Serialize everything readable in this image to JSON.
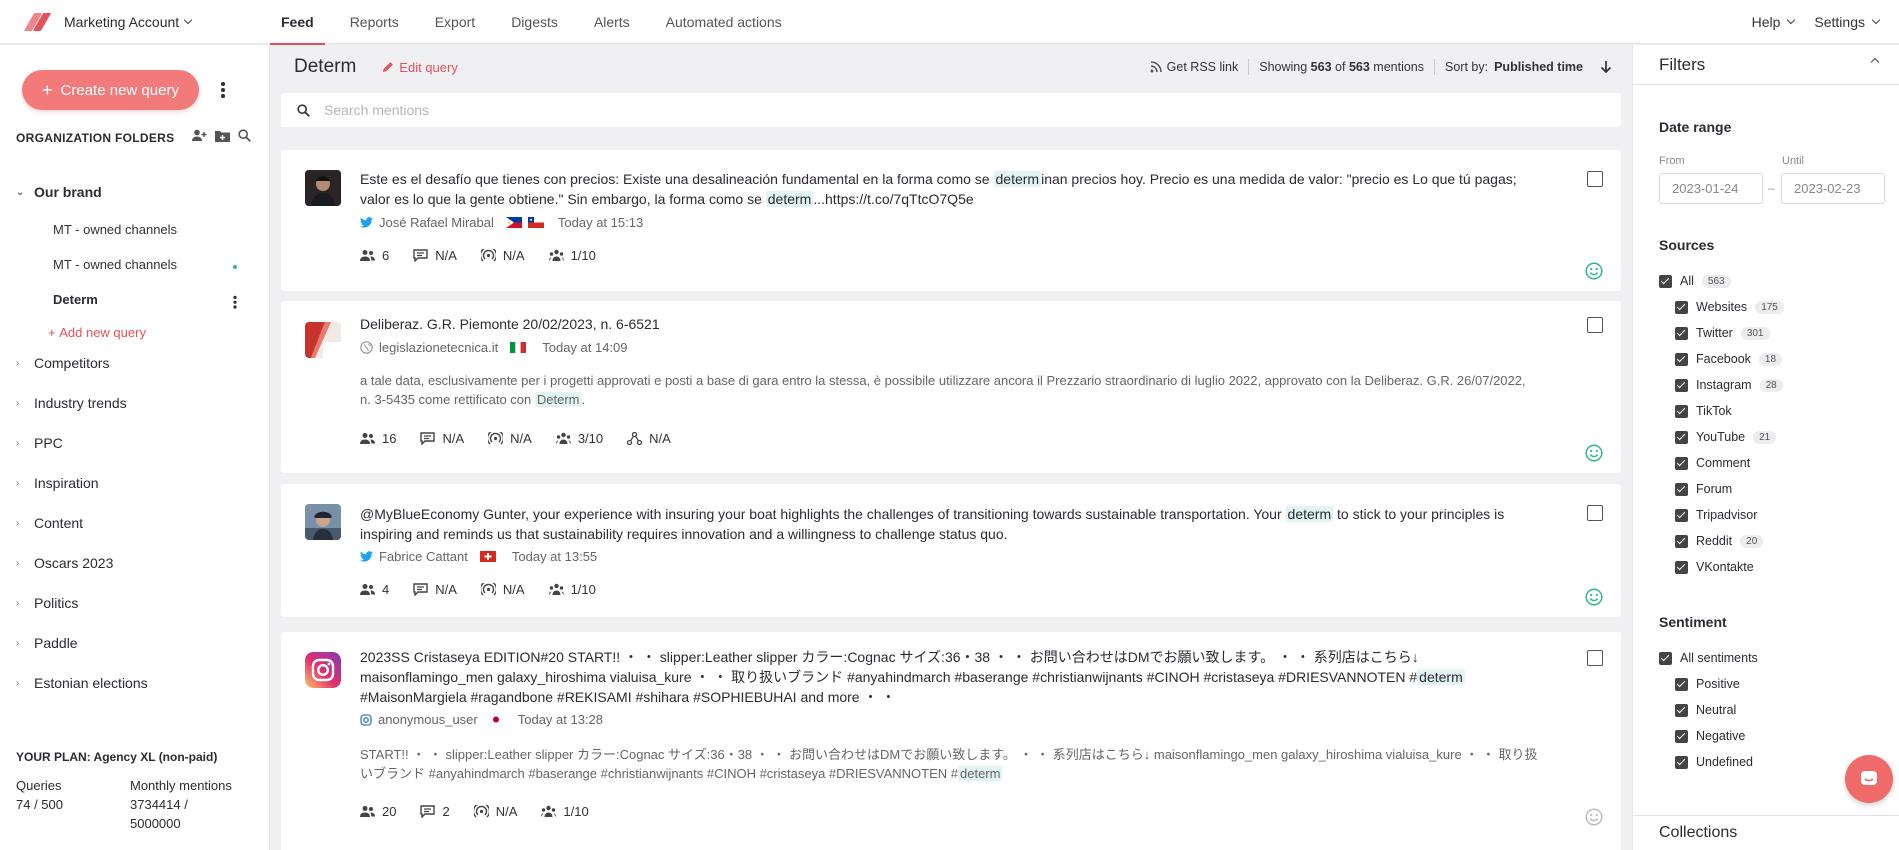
{
  "topnav": {
    "account": "Marketing Account",
    "tabs": [
      {
        "label": "Feed",
        "active": true
      },
      {
        "label": "Reports"
      },
      {
        "label": "Export"
      },
      {
        "label": "Digests"
      },
      {
        "label": "Alerts"
      },
      {
        "label": "Automated actions"
      }
    ],
    "help": "Help",
    "settings": "Settings"
  },
  "sidebar": {
    "create_button": "Create new query",
    "org_title": "ORGANIZATION FOLDERS",
    "open_folder": "Our brand",
    "children": [
      "MT - owned channels",
      "MT - owned channels",
      "Determ"
    ],
    "add_query": "Add new query",
    "folders": [
      "Competitors",
      "Industry trends",
      "PPC",
      "Inspiration",
      "Content",
      "Oscars 2023",
      "Politics",
      "Paddle",
      "Estonian elections"
    ],
    "plan": "YOUR PLAN: Agency XL (non-paid)",
    "queries_label": "Queries",
    "queries_value": "74 / 500",
    "mentions_label": "Monthly mentions",
    "mentions_value_1": "3734414 /",
    "mentions_value_2": "5000000"
  },
  "query": {
    "title": "Determ",
    "edit": "Edit query",
    "rss": "Get RSS link",
    "showing_prefix": "Showing",
    "shown": "563",
    "of": "of",
    "total": "563",
    "mentions": "mentions",
    "sort_label": "Sort by:",
    "sort_value": "Published time",
    "search_placeholder": "Search mentions"
  },
  "mentions": [
    {
      "title_parts": [
        "Este es el desafío que tienes con precios: Existe una desalineación fundamental en la forma como se ",
        "determ",
        "inan precios hoy. Precio es una medida de valor: \"precio es Lo que tú pagas; valor es lo que la gente obtiene.\" Sin embargo, la forma como se ",
        "determ",
        "...https://t.co/7qTtcO7Q5e"
      ],
      "author": "José Rafael Mirabal",
      "time": "Today at 15:13",
      "stats": [
        "6",
        "N/A",
        "N/A",
        "1/10"
      ],
      "sentiment_color": "#2fb88a"
    },
    {
      "title": "Deliberaz. G.R. Piemonte 20/02/2023, n. 6-6521",
      "author": "legislazionetecnica.it",
      "time": "Today at 14:09",
      "snippet_parts": [
        "a tale data, esclusivamente per i progetti approvati e posti a base di gara entro la stessa, è possibile utilizzare ancora il Prezzario straordinario di luglio 2022, approvato con la Deliberaz. G.R. 26/07/2022, n. 3-5435 come rettificato con ",
        "Determ",
        "."
      ],
      "stats": [
        "16",
        "N/A",
        "N/A",
        "3/10",
        "N/A"
      ],
      "sentiment_color": "#2fb88a"
    },
    {
      "title_parts": [
        "@MyBlueEconomy Gunter, your experience with insuring your boat highlights the challenges of transitioning towards sustainable transportation. Your ",
        "determ",
        " to stick to your principles is inspiring and reminds us that sustainability requires innovation and a willingness to challenge status quo."
      ],
      "author": "Fabrice Cattant",
      "time": "Today at 13:55",
      "stats": [
        "4",
        "N/A",
        "N/A",
        "1/10"
      ],
      "sentiment_color": "#2fb88a"
    },
    {
      "title_parts": [
        "2023SS Cristaseya EDITION#20 START!! ・ ・ slipper:Leather slipper カラー:Cognac サイズ:36・38 ・ ・ お問い合わせはDMでお願い致します。 ・ ・ 系列店はこちら↓ maisonflamingo_men galaxy_hiroshima vialuisa_kure ・ ・ 取り扱いブランド #anyahindmarch #baserange #christianwijnants #CINOH #cristaseya #DRIESVANNOTEN #",
        "determ",
        " #MaisonMargiela #ragandbone #REKISAMI #shihara #SOPHIEBUHAI and more ・ ・"
      ],
      "author": "anonymous_user",
      "time": "Today at 13:28",
      "snippet_parts": [
        "START!! ・ ・ slipper:Leather slipper カラー:Cognac サイズ:36・38 ・ ・ お問い合わせはDMでお願い致します。 ・ ・ 系列店はこちら↓ maisonflamingo_men galaxy_hiroshima vialuisa_kure ・ ・ 取り扱いブランド #anyahindmarch #baserange #christianwijnants #CINOH #cristaseya #DRIESVANNOTEN #",
        "determ"
      ],
      "stats": [
        "20",
        "2",
        "N/A",
        "1/10"
      ],
      "sentiment_color": "#bbbbbb"
    }
  ],
  "filters": {
    "title": "Filters",
    "date_range": "Date range",
    "from_label": "From",
    "until_label": "Until",
    "from": "2023-01-24",
    "until": "2023-02-23",
    "sources_title": "Sources",
    "sources_all": "All",
    "sources_all_count": "563",
    "sources": [
      {
        "label": "Websites",
        "count": "175"
      },
      {
        "label": "Twitter",
        "count": "301"
      },
      {
        "label": "Facebook",
        "count": "18"
      },
      {
        "label": "Instagram",
        "count": "28"
      },
      {
        "label": "TikTok"
      },
      {
        "label": "YouTube",
        "count": "21"
      },
      {
        "label": "Comment"
      },
      {
        "label": "Forum"
      },
      {
        "label": "Tripadvisor"
      },
      {
        "label": "Reddit",
        "count": "20"
      },
      {
        "label": "VKontakte"
      }
    ],
    "sentiment_title": "Sentiment",
    "sentiment_all": "All sentiments",
    "sentiments": [
      "Positive",
      "Neutral",
      "Negative",
      "Undefined"
    ],
    "collections": "Collections"
  },
  "colors": {
    "accent": "#e8515a",
    "button": "#f27a7a",
    "highlight": "#e1f4f2",
    "positive": "#2fb88a",
    "twitter": "#1da1f2"
  }
}
